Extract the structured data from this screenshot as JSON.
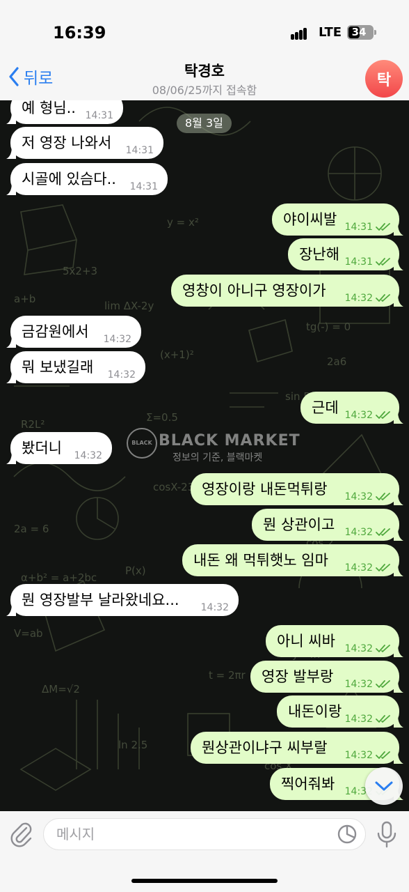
{
  "status": {
    "time": "16:39",
    "network": "LTE",
    "battery": "34"
  },
  "header": {
    "back_label": "뒤로",
    "title": "탁경호",
    "subtitle": "08/06/25까지 접속함",
    "avatar_letter": "탁"
  },
  "chat": {
    "date": "8월 3일",
    "messages": [
      {
        "dir": "in",
        "text": "예 형님..",
        "time": "14:31"
      },
      {
        "dir": "in",
        "text": "저 영장 나와서",
        "time": "14:31"
      },
      {
        "dir": "in",
        "text": "시골에 있슴다..",
        "time": "14:31"
      },
      {
        "dir": "out",
        "text": "야이씨발",
        "time": "14:31"
      },
      {
        "dir": "out",
        "text": "장난해",
        "time": "14:31"
      },
      {
        "dir": "out",
        "text": "영창이 아니구 영장이가",
        "time": "14:32"
      },
      {
        "dir": "in",
        "text": "금감원에서",
        "time": "14:32"
      },
      {
        "dir": "in",
        "text": "뭐 보냈길래",
        "time": "14:32"
      },
      {
        "dir": "out",
        "text": "근데",
        "time": "14:32"
      },
      {
        "dir": "in",
        "text": "봤더니",
        "time": "14:32"
      },
      {
        "dir": "out",
        "text": "영장이랑 내돈먹튀랑",
        "time": "14:32"
      },
      {
        "dir": "out",
        "text": "뭔 상관이고",
        "time": "14:32"
      },
      {
        "dir": "out",
        "text": "내돈 왜 먹튀햇노 임마",
        "time": "14:32"
      },
      {
        "dir": "in",
        "text": "뭔 영장발부 날라왔네요...",
        "time": "14:32"
      },
      {
        "dir": "out",
        "text": "아니 씨바",
        "time": "14:32"
      },
      {
        "dir": "out",
        "text": "영장 발부랑",
        "time": "14:32"
      },
      {
        "dir": "out",
        "text": "내돈이랑",
        "time": "14:32"
      },
      {
        "dir": "out",
        "text": "뭔상관이냐구 씨부랄",
        "time": "14:32"
      },
      {
        "dir": "out",
        "text": "찍어줘봐",
        "time": "14:32"
      }
    ]
  },
  "watermark": {
    "logo_text": "BLACK MARKET",
    "title": "BLACK MARKET",
    "subtitle": "정보의 기준, 블랙마켓"
  },
  "input": {
    "placeholder": "메시지"
  },
  "icons": {
    "back": "chevron-left-icon",
    "attach": "paperclip-icon",
    "sticker": "sticker-icon",
    "mic": "microphone-icon",
    "scroll": "chevron-down-icon",
    "read": "double-check-icon"
  },
  "colors": {
    "accent": "#2a7ef0",
    "incoming_bubble": "#ffffff",
    "outgoing_bubble": "#e2fcc8",
    "outgoing_time": "#4fa83d",
    "avatar": "#f2474a"
  }
}
